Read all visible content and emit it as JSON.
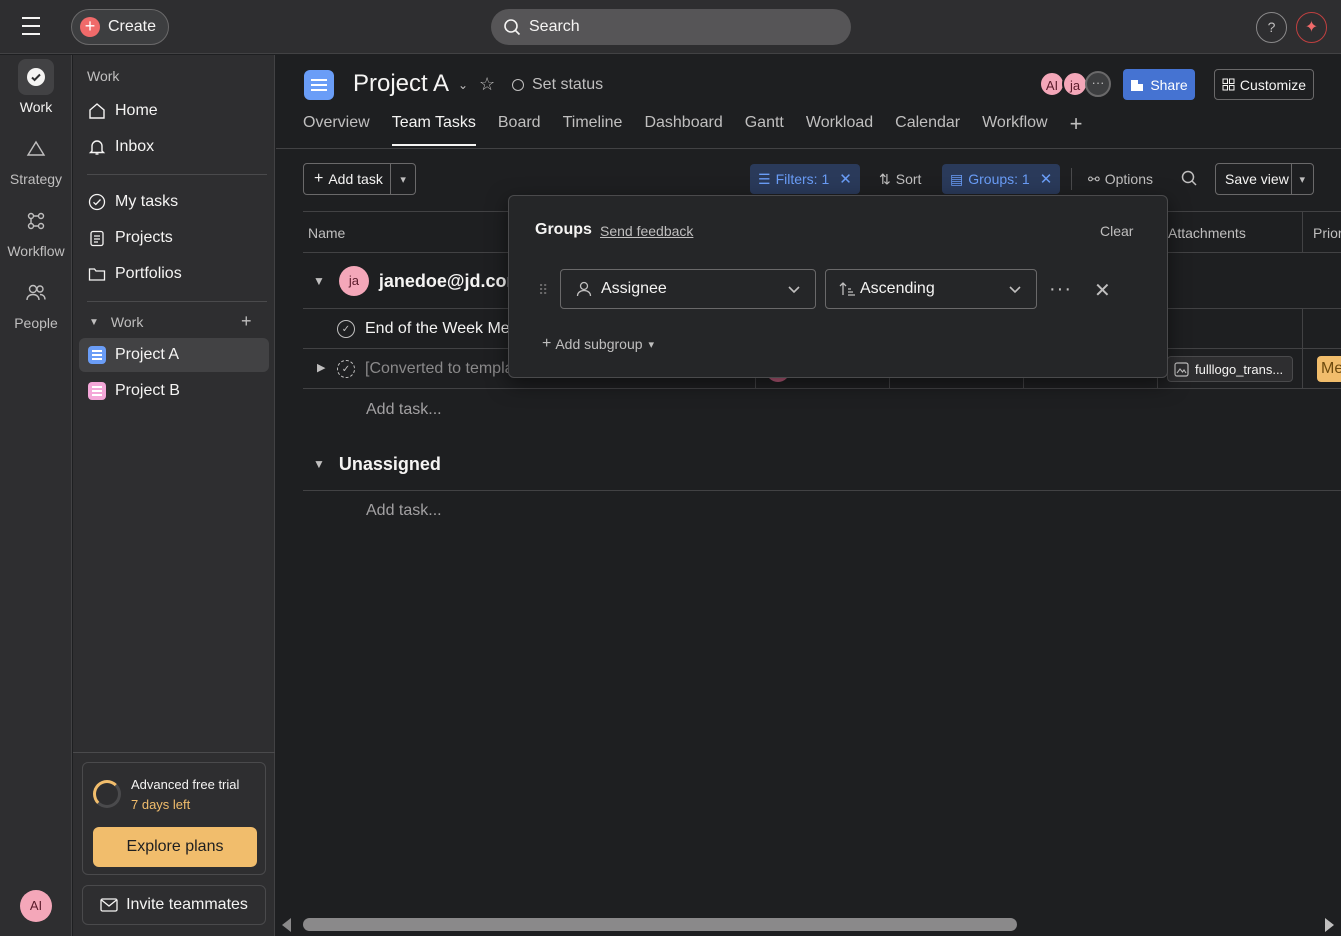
{
  "topbar": {
    "create_label": "Create",
    "search_placeholder": "Search",
    "help_label": "?"
  },
  "rail": {
    "items": [
      {
        "label": "Work",
        "icon": "check-circle-icon"
      },
      {
        "label": "Strategy",
        "icon": "triangle-icon"
      },
      {
        "label": "Workflow",
        "icon": "workflow-icon"
      },
      {
        "label": "People",
        "icon": "people-icon"
      }
    ],
    "avatar_initials": "AI"
  },
  "sidebar": {
    "section_label": "Work",
    "nav": [
      {
        "label": "Home",
        "icon": "home-icon"
      },
      {
        "label": "Inbox",
        "icon": "bell-icon"
      }
    ],
    "nav2": [
      {
        "label": "My tasks",
        "icon": "check-circle-icon"
      },
      {
        "label": "Projects",
        "icon": "clipboard-icon"
      },
      {
        "label": "Portfolios",
        "icon": "folder-icon"
      }
    ],
    "work_group_label": "Work",
    "projects": [
      {
        "label": "Project A",
        "color": "#6a9df7"
      },
      {
        "label": "Project B",
        "color": "#f4a7d8"
      }
    ],
    "trial": {
      "title": "Advanced free trial",
      "days_left": "7 days left",
      "explore_label": "Explore plans"
    },
    "invite_label": "Invite teammates"
  },
  "project": {
    "title": "Project A",
    "set_status_label": "Set status",
    "members": [
      "AI",
      "ja"
    ],
    "share_label": "Share",
    "customize_label": "Customize",
    "tabs": [
      "Overview",
      "Team Tasks",
      "Board",
      "Timeline",
      "Dashboard",
      "Gantt",
      "Workload",
      "Calendar",
      "Workflow"
    ],
    "active_tab": "Team Tasks"
  },
  "toolbar": {
    "add_task_label": "Add task",
    "filters_label": "Filters: 1",
    "sort_label": "Sort",
    "groups_label": "Groups: 1",
    "options_label": "Options",
    "save_view_label": "Save view"
  },
  "table": {
    "columns": {
      "name": "Name",
      "attachments": "Attachments",
      "priority": "Prior"
    },
    "groups": [
      {
        "initials": "ja",
        "title": "janedoe@jd.cor",
        "rows": [
          {
            "name": "End of the Week Mee"
          },
          {
            "name": "[Converted to templa",
            "attachment": "fulllogo_trans...",
            "priority": "Me"
          }
        ],
        "add_task": "Add task..."
      },
      {
        "title": "Unassigned",
        "add_task": "Add task..."
      }
    ]
  },
  "groups_popover": {
    "title": "Groups",
    "feedback_label": "Send feedback",
    "clear_label": "Clear",
    "field_value": "Assignee",
    "order_value": "Ascending",
    "add_subgroup_label": "Add subgroup"
  }
}
